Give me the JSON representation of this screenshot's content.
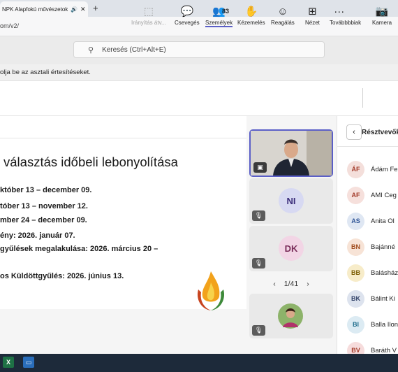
{
  "browser": {
    "tab_title": "NPK Alapfokú művészetoktatá",
    "tab_audio_icon": "speaker-icon",
    "url": "om/v2/"
  },
  "teams": {
    "search_placeholder": "Keresés (Ctrl+Alt+E)",
    "notification": "olja be az asztali értesítéseket."
  },
  "toolbar": {
    "control": "Irányítás átv...",
    "chat": "Csevegés",
    "people": "Személyek",
    "people_count": "83",
    "raise_hand": "Kézemelés",
    "react": "Reagálás",
    "view": "Nézet",
    "more": "További",
    "more2": "bbiak",
    "camera": "Kamera"
  },
  "slide": {
    "title": " választás időbeli lebonyolítása",
    "lines": [
      "któber 13 – december 09.",
      "tóber 13 – november 12.",
      "mber 24 – december 09.",
      "ény: 2026. január 07.",
      "gyűlések megalakulása: 2026. március 20 –",
      "os Küldöttgyűlés: 2026. június 13."
    ]
  },
  "tiles": {
    "t2_initials": "NI",
    "t3_initials": "DK",
    "pager": "1/41"
  },
  "panel": {
    "title": "Résztvevők",
    "participants": [
      {
        "initials": "ÁF",
        "name": "Ádám Fe",
        "color": "#f4dfdb",
        "text": "#a33b2a"
      },
      {
        "initials": "AF",
        "name": "AMI Ceg",
        "color": "#f6e0dc",
        "text": "#a33b2a"
      },
      {
        "initials": "AS",
        "name": "Anita Ol",
        "color": "#dfe7f3",
        "text": "#2f5496"
      },
      {
        "initials": "BN",
        "name": "Bajánné",
        "color": "#f7e3d6",
        "text": "#a04b1c"
      },
      {
        "initials": "BB",
        "name": "Balásház",
        "color": "#f7ecc9",
        "text": "#7a5b00"
      },
      {
        "initials": "BK",
        "name": "Bálint Ki",
        "color": "#dde3ee",
        "text": "#2f3f66"
      },
      {
        "initials": "BI",
        "name": "Balla Ilon",
        "color": "#dcebf3",
        "text": "#1f6d8c"
      },
      {
        "initials": "BV",
        "name": "Baráth V",
        "color": "#f6dcdc",
        "text": "#a33b2a"
      }
    ]
  }
}
